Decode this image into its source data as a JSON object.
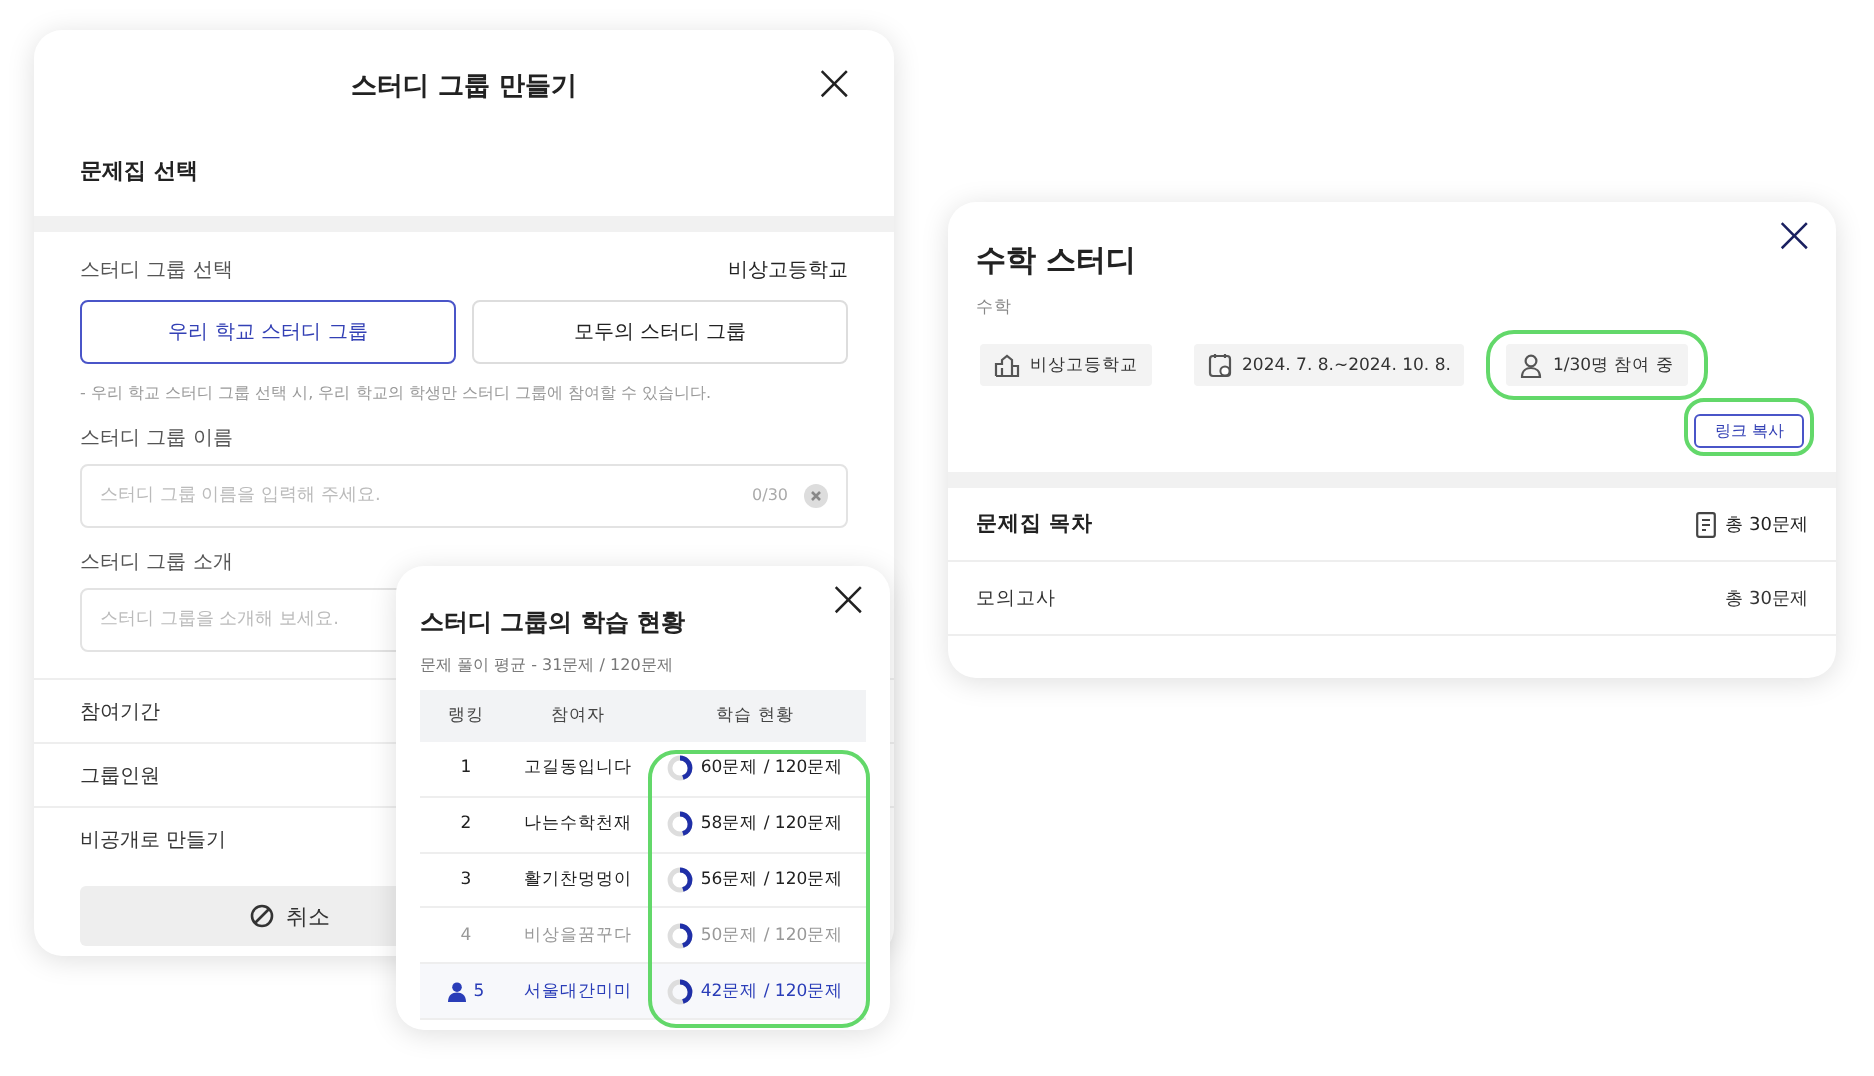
{
  "create_dialog": {
    "title": "스터디 그룹 만들기",
    "close": "×",
    "workbook_label": "문제집 선택",
    "group_type_label": "스터디 그룹 선택",
    "school": "비상고등학교",
    "group_types": [
      {
        "label": "우리 학교 스터디 그룹",
        "selected": true
      },
      {
        "label": "모두의 스터디 그룹",
        "selected": false
      }
    ],
    "hint": "- 우리 학교 스터디 그룹 선택 시, 우리 학교의 학생만 스터디 그룹에 참여할 수 있습니다.",
    "name_label": "스터디 그룹 이름",
    "name_placeholder": "스터디 그룹 이름을 입력해 주세요.",
    "name_counter": "0/30",
    "intro_label": "스터디 그룹 소개",
    "intro_placeholder": "스터디 그룹을 소개해 보세요.",
    "rows": [
      "참여기간",
      "그룹인원",
      "비공개로 만들기"
    ],
    "cancel": "취소"
  },
  "progress_popup": {
    "title": "스터디 그룹의 학습 현황",
    "subtitle": "문제 풀이 평균 - 31문제 / 120문제",
    "columns": [
      "랭킹",
      "참여자",
      "학습 현황"
    ],
    "status_highlighted": true,
    "rows": [
      {
        "rank": "1",
        "name": "고길동입니다",
        "status": "60문제 / 120문제",
        "dimmed": false,
        "me": false
      },
      {
        "rank": "2",
        "name": "나는수학천재",
        "status": "58문제 / 120문제",
        "dimmed": false,
        "me": false
      },
      {
        "rank": "3",
        "name": "활기찬멍멍이",
        "status": "56문제 / 120문제",
        "dimmed": false,
        "me": false
      },
      {
        "rank": "4",
        "name": "비상을꿈꾸다",
        "status": "50문제 / 120문제",
        "dimmed": true,
        "me": false
      },
      {
        "rank": "5",
        "name": "서울대간미미",
        "status": "42문제 / 120문제",
        "dimmed": false,
        "me": true
      }
    ]
  },
  "study_card": {
    "title": "수학 스터디",
    "subject": "수학",
    "chips": [
      {
        "kind": "school",
        "label": "비상고등학교",
        "highlighted": false
      },
      {
        "kind": "period",
        "label": "2024. 7. 8.~2024. 10. 8.",
        "highlighted": false
      },
      {
        "kind": "members",
        "label": "1/30명 참여 중",
        "highlighted": true
      }
    ],
    "copy_link": {
      "label": "링크 복사",
      "highlighted": true
    },
    "toc_title": "문제집 목차",
    "toc_total": "총 30문제",
    "items": [
      {
        "name": "모의고사",
        "count": "총 30문제"
      }
    ]
  }
}
